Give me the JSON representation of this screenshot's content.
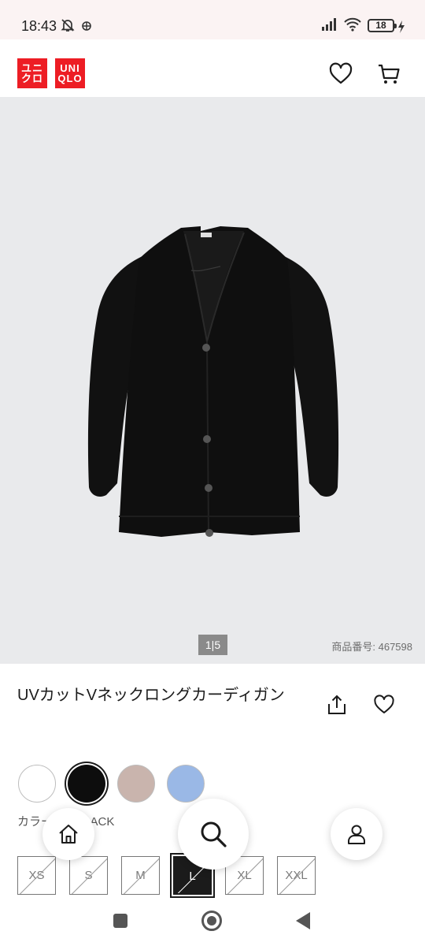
{
  "status_bar": {
    "time": "18:43",
    "battery": "18"
  },
  "header": {
    "logo_left": [
      "ユニ",
      "クロ"
    ],
    "logo_right": [
      "UNI",
      "QLO"
    ]
  },
  "gallery": {
    "pager": "1|5",
    "item_code": "商品番号: 467598"
  },
  "product": {
    "title": "UVカットVネックロングカーディガン",
    "color_label": "カラー: 09 BLACK",
    "swatches": [
      {
        "color": "#ffffff",
        "selected": false
      },
      {
        "color": "#0d0d0d",
        "selected": true
      },
      {
        "color": "#c9b4ad",
        "selected": false
      },
      {
        "color": "#9ab8e6",
        "selected": false
      }
    ],
    "sizes": [
      "XS",
      "S",
      "M",
      "L",
      "XL",
      "XXL"
    ],
    "selected_size": "L"
  },
  "colors": {
    "brand_red": "#ed1d24"
  }
}
